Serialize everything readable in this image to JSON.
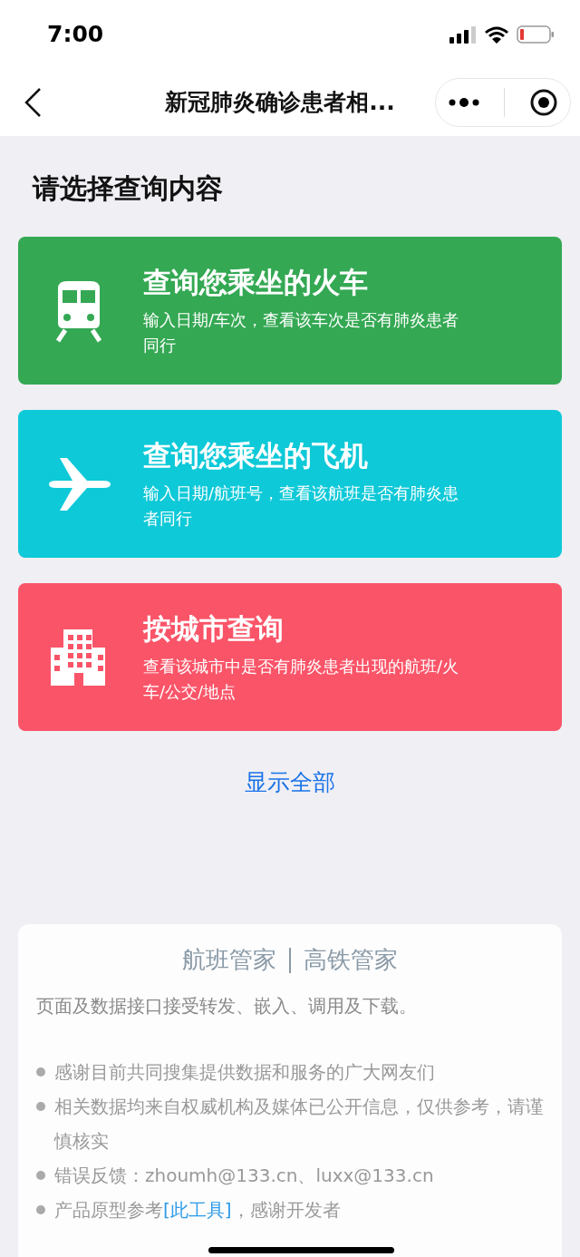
{
  "status_bar": {
    "time": "7:00"
  },
  "nav": {
    "title": "新冠肺炎确诊患者相..."
  },
  "heading": "请选择查询内容",
  "cards": [
    {
      "kind": "train",
      "color": "#34a853",
      "title": "查询您乘坐的火车",
      "subtitle": "输入日期/车次，查看该车次是否有肺炎患者同行"
    },
    {
      "kind": "plane",
      "color": "#0ec9d8",
      "title": "查询您乘坐的飞机",
      "subtitle": "输入日期/航班号，查看该航班是否有肺炎患者同行"
    },
    {
      "kind": "city",
      "color": "#fa5468",
      "title": "按城市查询",
      "subtitle": "查看该城市中是否有肺炎患者出现的航班/火车/公交/地点"
    }
  ],
  "show_all": "显示全部",
  "footer": {
    "brands": [
      "航班管家",
      "高铁管家"
    ],
    "intro": "页面及数据接口接受转发、嵌入、调用及下载。",
    "bullets": [
      {
        "text": "感谢目前共同搜集提供数据和服务的广大网友们"
      },
      {
        "text": "相关数据均来自权威机构及媒体已公开信息，仅供参考，请谨慎核实"
      },
      {
        "text": "错误反馈：zhoumh@133.cn、luxx@133.cn"
      },
      {
        "text": "产品原型参考",
        "link": "[此工具]",
        "after": "，感谢开发者"
      }
    ]
  }
}
